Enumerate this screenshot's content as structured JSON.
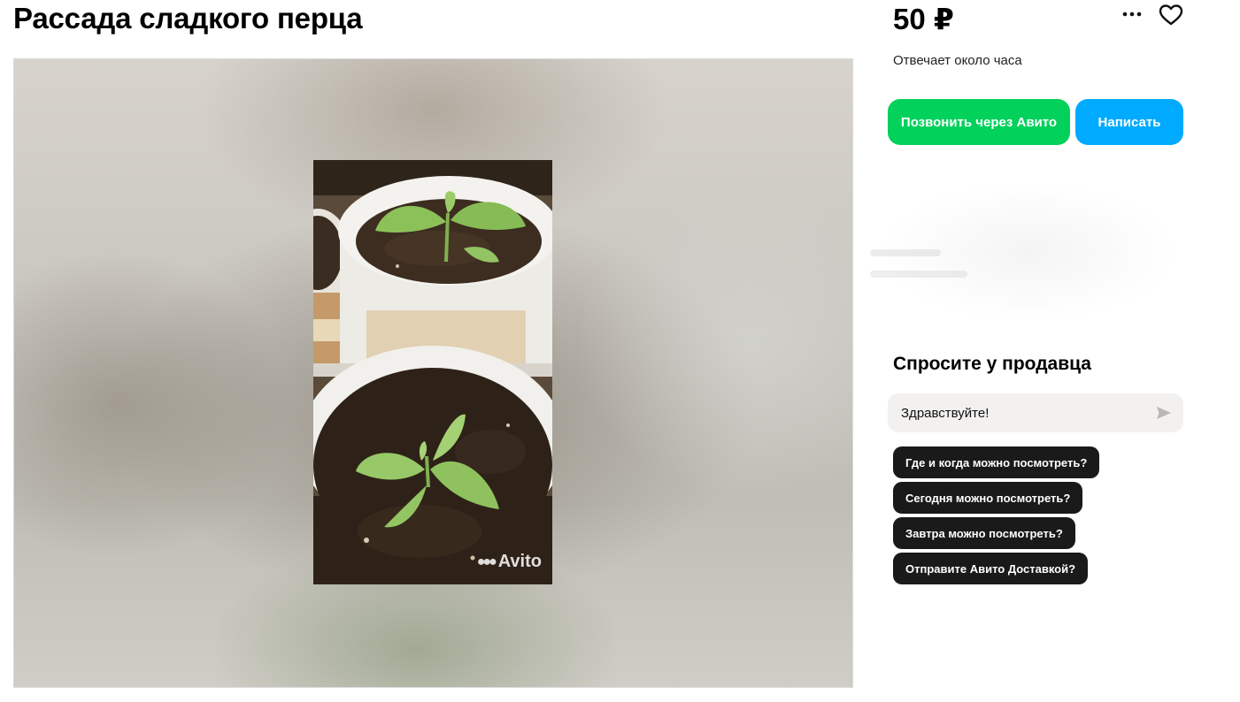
{
  "listing": {
    "title": "Рассада сладкого перца",
    "price": "50 ₽",
    "reply_time": "Отвечает около часа"
  },
  "actions": {
    "call_label": "Позвонить через Авито",
    "write_label": "Написать",
    "call_color": "#02d15c",
    "write_color": "#00aaff"
  },
  "header_icons": [
    "more-icon",
    "heart-icon"
  ],
  "photo": {
    "watermark": "Avito"
  },
  "ask_seller": {
    "title": "Спросите у продавца",
    "message_value": "Здравствуйте!",
    "send_icon": "send-icon",
    "quick_questions": [
      "Где и когда можно посмотреть?",
      "Сегодня можно посмотреть?",
      "Завтра можно посмотреть?",
      "Отправите Авито Доставкой?"
    ]
  }
}
